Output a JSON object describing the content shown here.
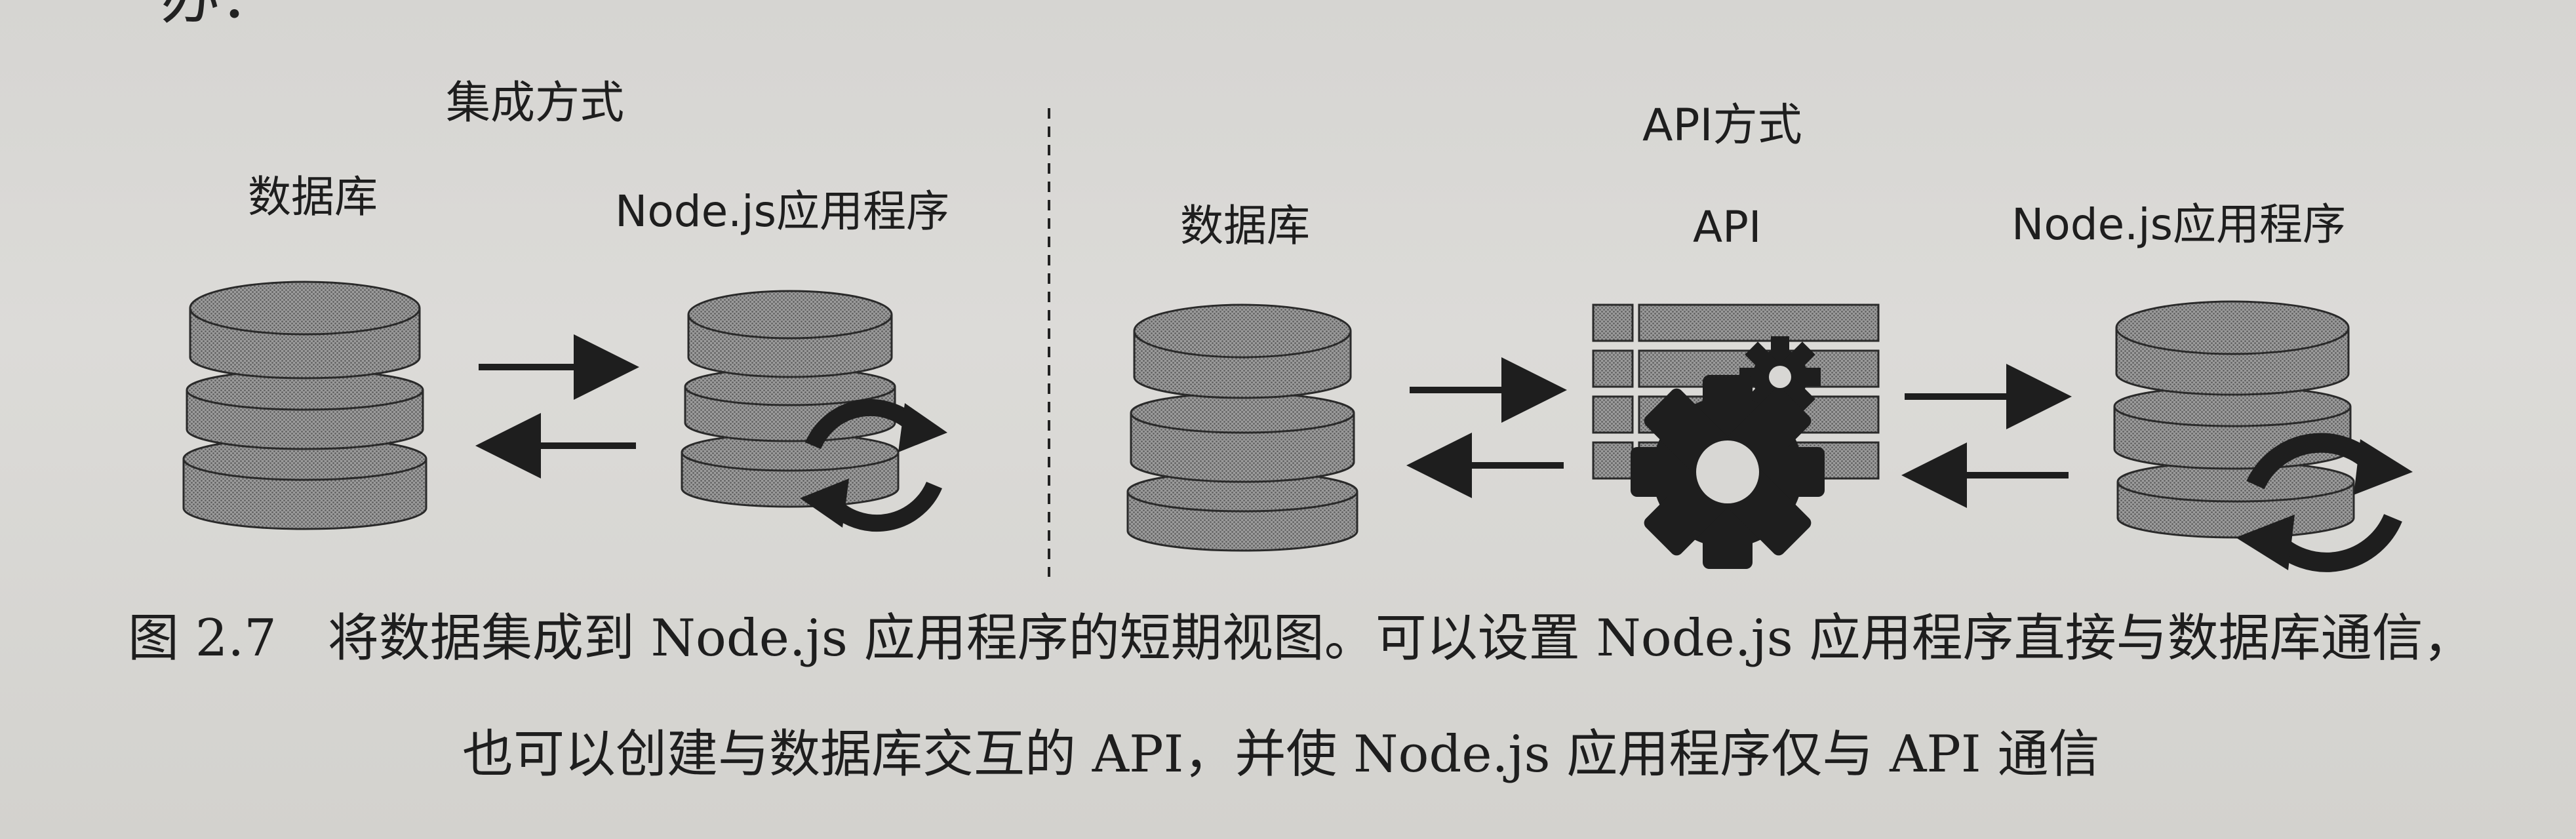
{
  "previous_page_text": "办：",
  "integration": {
    "title": "集成方式",
    "database_label": "数据库",
    "app_label": "Node.js应用程序"
  },
  "api_approach": {
    "title": "API方式",
    "database_label": "数据库",
    "api_label": "API",
    "app_label": "Node.js应用程序"
  },
  "caption": {
    "line1": "图 2.7　将数据集成到 Node.js 应用程序的短期视图。可以设置 Node.js 应用程序直接与数据库通信，",
    "line2": "也可以创建与数据库交互的 API，并使 Node.js 应用程序仅与 API 通信"
  },
  "icons": {
    "database": "database-icon",
    "sync": "sync-icon",
    "api": "api-table-gear-icon",
    "arrow_right": "arrow-right-icon",
    "arrow_left": "arrow-left-icon"
  },
  "colors": {
    "page": "#d8d7d4",
    "ink": "#1e1e1e",
    "cylinder_fill": "#8f8f8f"
  }
}
